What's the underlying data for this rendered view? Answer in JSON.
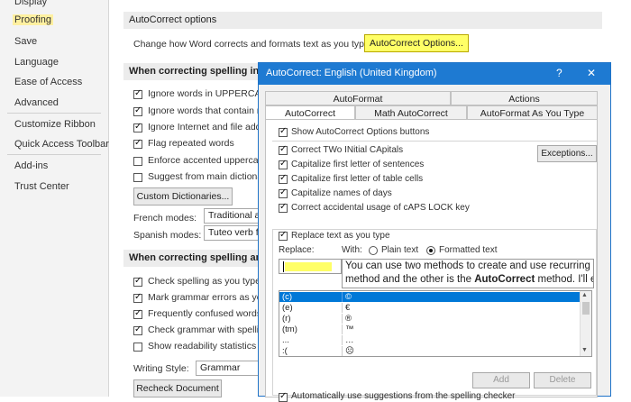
{
  "nav": {
    "items": [
      "Display",
      "Proofing",
      "Save",
      "Language",
      "Ease of Access",
      "Advanced",
      "Customize Ribbon",
      "Quick Access Toolbar",
      "Add-ins",
      "Trust Center"
    ],
    "selected": "Proofing"
  },
  "main": {
    "autocorrect_heading": "AutoCorrect options",
    "autocorrect_desc": "Change how Word corrects and formats text as you type:",
    "autocorrect_button": "AutoCorrect Options...",
    "spelling_heading": "When correcting spelling in Mic",
    "spelling_options": [
      {
        "label": "Ignore words in UPPERCASE",
        "checked": true
      },
      {
        "label": "Ignore words that contain nu",
        "checked": true
      },
      {
        "label": "Ignore Internet and file addre",
        "checked": true
      },
      {
        "label": "Flag repeated words",
        "checked": true
      },
      {
        "label": "Enforce accented uppercase",
        "checked": false
      },
      {
        "label": "Suggest from main dictiona",
        "checked": false
      }
    ],
    "custom_dictionaries_button": "Custom Dictionaries...",
    "french_modes_label": "French modes:",
    "french_modes_value": "Traditional an",
    "spanish_modes_label": "Spanish modes:",
    "spanish_modes_value": "Tuteo verb fo",
    "grammar_heading": "When correcting spelling and gr",
    "grammar_options": [
      {
        "label": "Check spelling as you type",
        "checked": true
      },
      {
        "label": "Mark grammar errors as you",
        "checked": true
      },
      {
        "label": "Frequently confused words",
        "checked": true
      },
      {
        "label": "Check grammar with spelling",
        "checked": true
      },
      {
        "label": "Show readability statistics",
        "checked": false
      }
    ],
    "writing_style_label": "Writing Style:",
    "writing_style_value": "Grammar",
    "recheck_button": "Recheck Document"
  },
  "dialog": {
    "title": "AutoCorrect: English (United Kingdom)",
    "help_glyph": "?",
    "close_glyph": "✕",
    "tabs_top": [
      "AutoFormat",
      "Actions"
    ],
    "tabs_bottom": [
      "AutoCorrect",
      "Math AutoCorrect",
      "AutoFormat As You Type"
    ],
    "active_tab": "AutoCorrect",
    "show_buttons_label": "Show AutoCorrect Options buttons",
    "options": [
      {
        "label": "Correct TWo INitial CApitals",
        "checked": true
      },
      {
        "label": "Capitalize first letter of sentences",
        "checked": true
      },
      {
        "label": "Capitalize first letter of table cells",
        "checked": true
      },
      {
        "label": "Capitalize names of days",
        "checked": true
      },
      {
        "label": "Correct accidental usage of cAPS LOCK key",
        "checked": true
      }
    ],
    "exceptions_button": "Exceptions...",
    "replace_text_label": "Replace text as you type",
    "replace_label": "Replace:",
    "with_label": "With:",
    "plain_text_label": "Plain text",
    "formatted_text_label": "Formatted text",
    "with_text_line1": "You can use two methods to create and use recurring w",
    "with_text_line2_pre": "method and the other is the ",
    "with_text_line2_bold": "AutoCorrect",
    "with_text_line2_post": " method. I'll ex",
    "table_rows": [
      {
        "replace": "(c)",
        "with": "©"
      },
      {
        "replace": "(e)",
        "with": "€"
      },
      {
        "replace": "(r)",
        "with": "®"
      },
      {
        "replace": "(tm)",
        "with": "™"
      },
      {
        "replace": "...",
        "with": "…"
      },
      {
        "replace": ":(",
        "with": "☹"
      }
    ],
    "add_button": "Add",
    "delete_button": "Delete",
    "auto_suggest_label": "Automatically use suggestions from the spelling checker"
  },
  "colors": {
    "accent": "#1e7ad2",
    "highlight": "#ffff66",
    "selected_row": "#0078d7"
  }
}
